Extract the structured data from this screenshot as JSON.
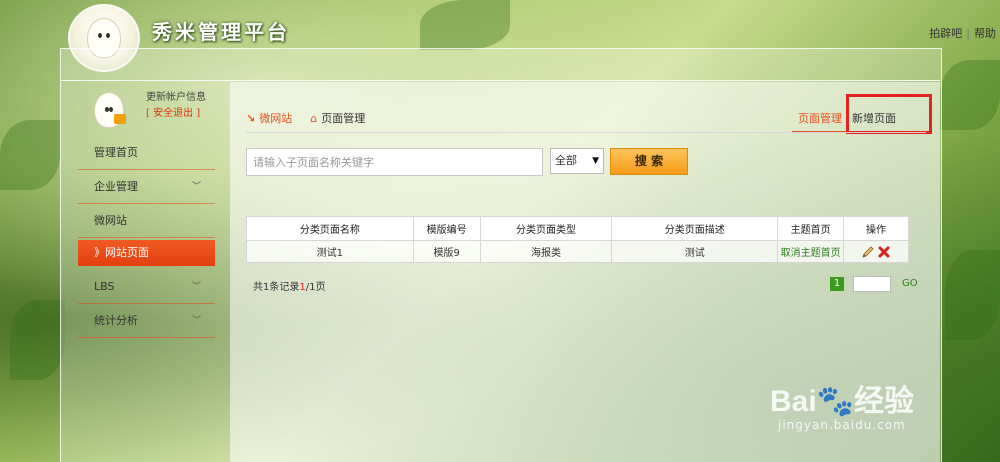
{
  "header": {
    "brand": "秀米管理平台",
    "links": [
      "拍辟吧",
      "帮助"
    ]
  },
  "sidebar": {
    "update_account": "更新帐户信息",
    "logout": "[ 安全退出 ]",
    "items": [
      {
        "label": "管理首页"
      },
      {
        "label": "企业管理"
      },
      {
        "label": "微网站"
      },
      {
        "label": "》网站页面"
      },
      {
        "label": "LBS"
      },
      {
        "label": "统计分析"
      }
    ]
  },
  "breadcrumb": {
    "arrow": "↘",
    "site": "微网站",
    "page": "页面管理"
  },
  "tabs": {
    "manage": "页面管理",
    "new": "新增页面"
  },
  "search": {
    "placeholder": "请输入子页面名称关键字",
    "select_value": "全部",
    "button": "搜 索"
  },
  "table": {
    "headers": [
      "分类页面名称",
      "模版编号",
      "分类页面类型",
      "分类页面描述",
      "主题首页",
      "操作"
    ],
    "rows": [
      {
        "name": "测试1",
        "template": "模版9",
        "type": "海报类",
        "desc": "测试",
        "theme": "取消主题首页"
      }
    ]
  },
  "pagination": {
    "summary_prefix": "共1条记录",
    "current": "1",
    "summary_suffix": "/1页",
    "page": "1",
    "go": "GO"
  },
  "watermark": {
    "brand_a": "Bai",
    "brand_b": "经验",
    "url": "jingyan.baidu.com"
  },
  "colors": {
    "accent": "#e8501e",
    "highlight": "#e32222",
    "link": "#2e7d1c"
  }
}
